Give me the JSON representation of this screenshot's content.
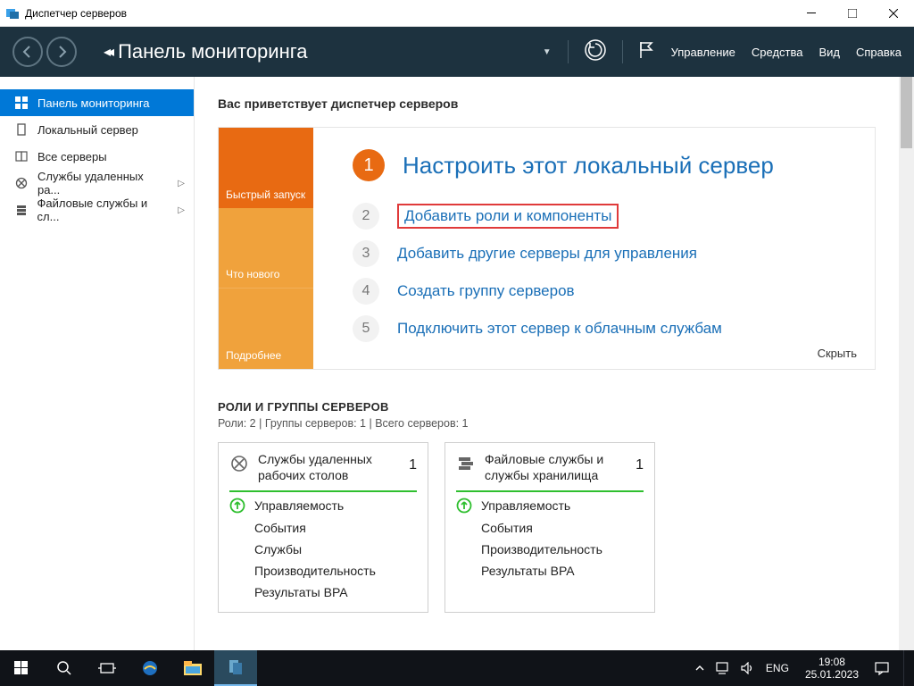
{
  "window": {
    "title": "Диспетчер серверов"
  },
  "header": {
    "title": "Панель мониторинга",
    "menu": {
      "manage": "Управление",
      "tools": "Средства",
      "view": "Вид",
      "help": "Справка"
    }
  },
  "sidebar": {
    "items": [
      {
        "label": "Панель мониторинга",
        "icon": "dashboard"
      },
      {
        "label": "Локальный сервер",
        "icon": "server"
      },
      {
        "label": "Все серверы",
        "icon": "servers"
      },
      {
        "label": "Службы удаленных ра...",
        "icon": "remote",
        "expand": true
      },
      {
        "label": "Файловые службы и сл...",
        "icon": "files",
        "expand": true
      }
    ]
  },
  "welcome": {
    "heading": "Вас приветствует диспетчер серверов",
    "tabs": {
      "quick": "Быстрый запуск",
      "whatsnew": "Что нового",
      "learn": "Подробнее"
    },
    "steps": [
      {
        "n": "1",
        "text": "Настроить этот локальный сервер"
      },
      {
        "n": "2",
        "text": "Добавить роли и компоненты"
      },
      {
        "n": "3",
        "text": "Добавить другие серверы для управления"
      },
      {
        "n": "4",
        "text": "Создать группу серверов"
      },
      {
        "n": "5",
        "text": "Подключить этот сервер к облачным службам"
      }
    ],
    "hide": "Скрыть"
  },
  "roles": {
    "title": "РОЛИ И ГРУППЫ СЕРВЕРОВ",
    "subtitle": "Роли: 2 | Группы серверов: 1 | Всего серверов: 1",
    "tiles": [
      {
        "title": "Службы удаленных рабочих столов",
        "count": "1",
        "rows": [
          "Управляемость",
          "События",
          "Службы",
          "Производительность",
          "Результаты BPA"
        ]
      },
      {
        "title": "Файловые службы и службы хранилища",
        "count": "1",
        "rows": [
          "Управляемость",
          "События",
          "Производительность",
          "Результаты BPA"
        ]
      }
    ]
  },
  "taskbar": {
    "lang": "ENG",
    "time": "19:08",
    "date": "25.01.2023"
  }
}
